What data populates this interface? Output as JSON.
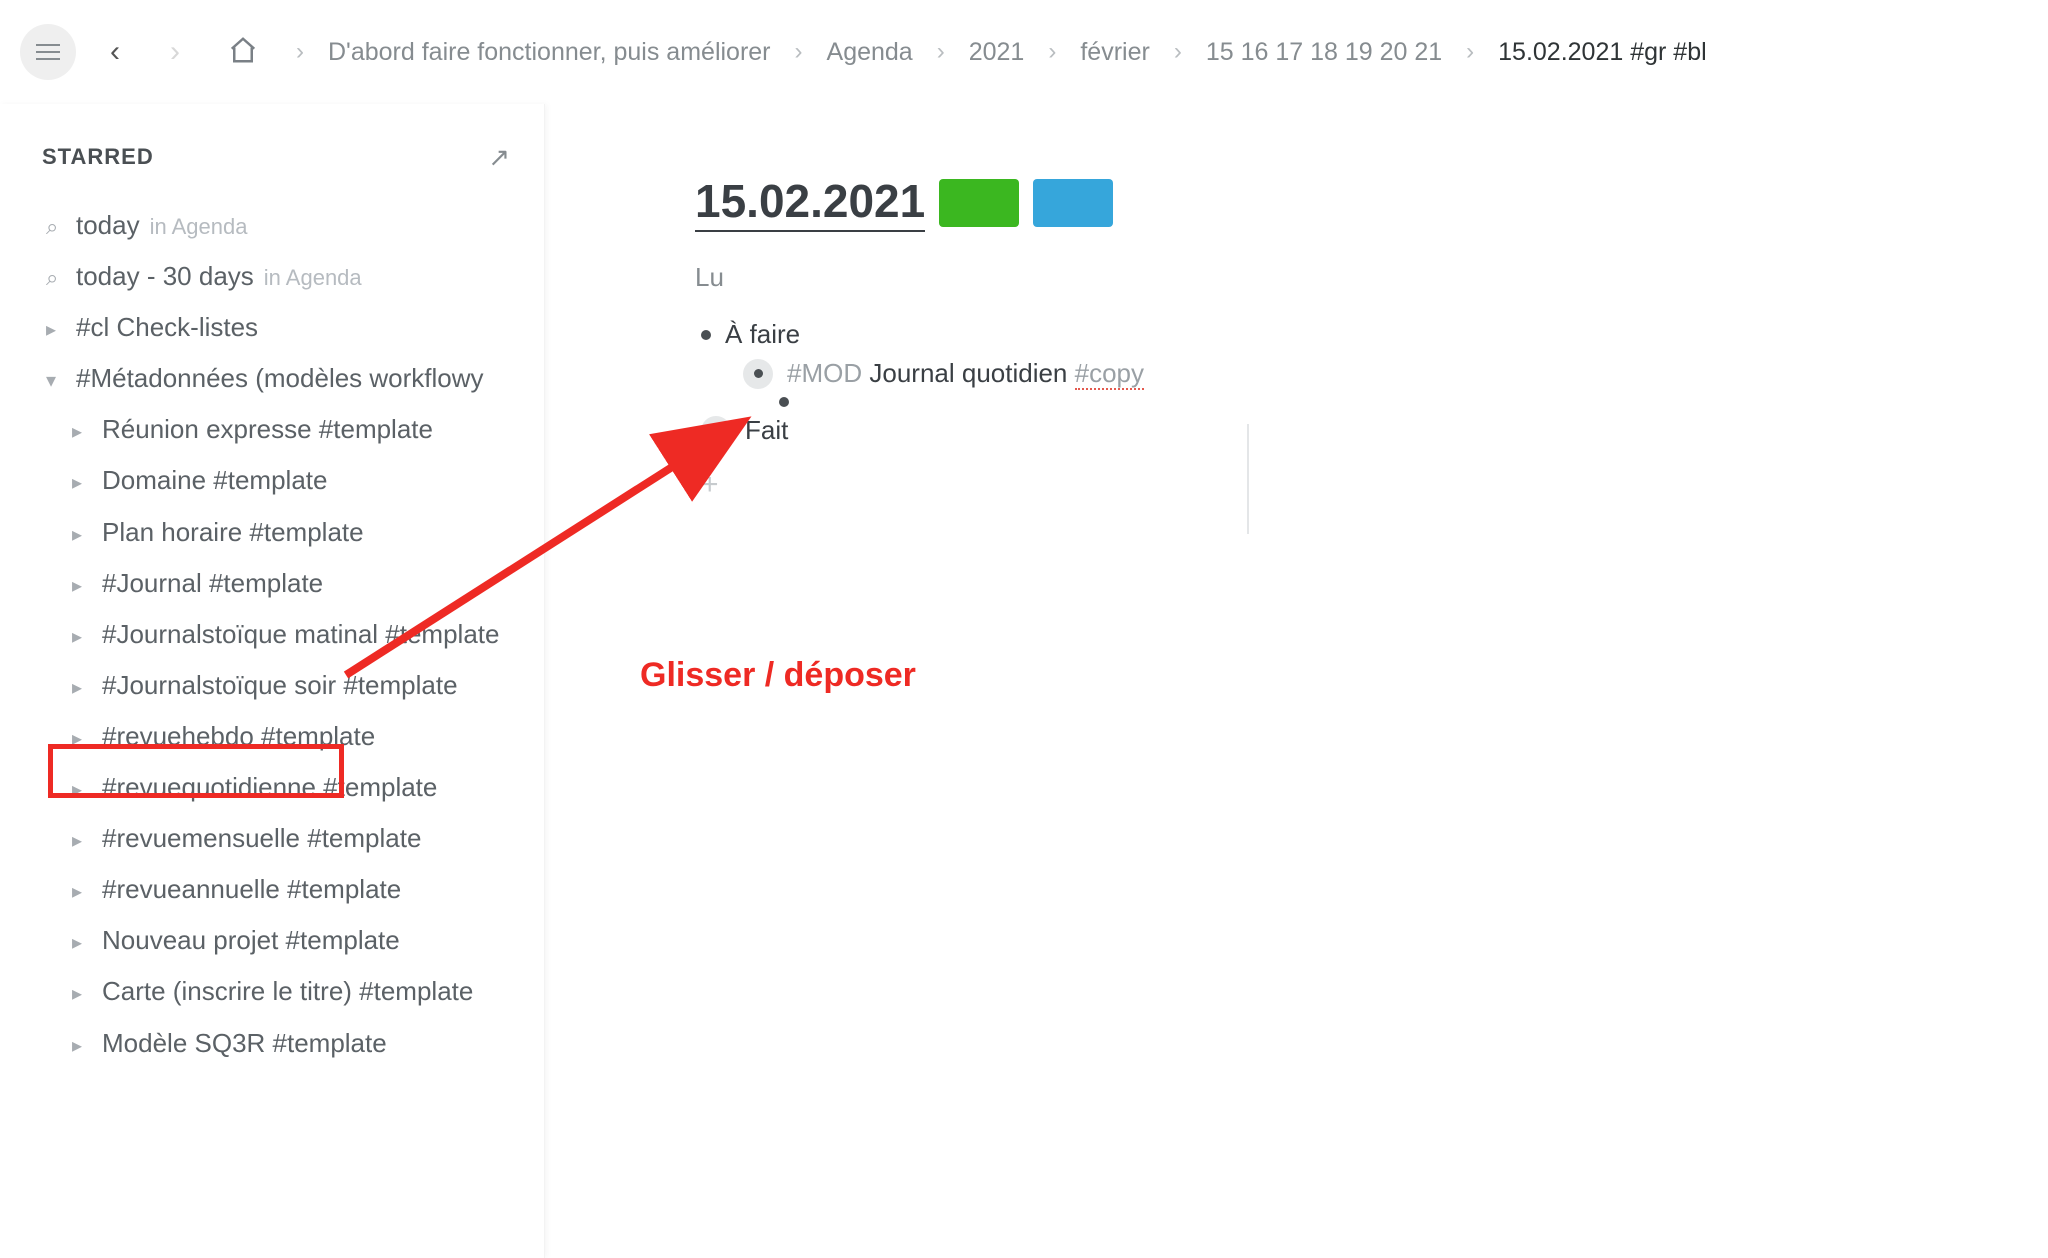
{
  "breadcrumbs": {
    "items": [
      "D'abord faire fonctionner, puis améliorer",
      "Agenda",
      "2021",
      "février",
      "15 16 17 18 19 20 21",
      "15.02.2021 #gr #bl"
    ]
  },
  "sidebar": {
    "title": "STARRED",
    "search1": {
      "label": "today",
      "sub": "in Agenda"
    },
    "search2": {
      "label": "today - 30 days",
      "sub": "in Agenda"
    },
    "items": [
      "#cl Check-listes",
      "#Métadonnées (modèles workflowy",
      "Réunion expresse #template",
      "Domaine #template",
      "Plan horaire #template",
      "#Journal #template",
      "#Journalstoïque matinal #template",
      "#Journalstoïque soir #template",
      "#revuehebdo #template",
      "#revuequotidienne #template",
      "#revuemensuelle #template",
      "#revueannuelle #template",
      "Nouveau projet #template",
      "Carte (inscrire le titre) #template",
      "Modèle SQ3R #template"
    ]
  },
  "page": {
    "title": "15.02.2021",
    "subtitle": "Lu",
    "swatch1": "#3bb720",
    "swatch2": "#36a6db",
    "todo_label": "À faire",
    "mod_tag": "#MOD",
    "mod_text": "Journal quotidien",
    "copy_tag": "#copy",
    "done_label": "Fait"
  },
  "annotation": {
    "label": "Glisser / déposer",
    "arrow_color": "#ee2a24"
  }
}
